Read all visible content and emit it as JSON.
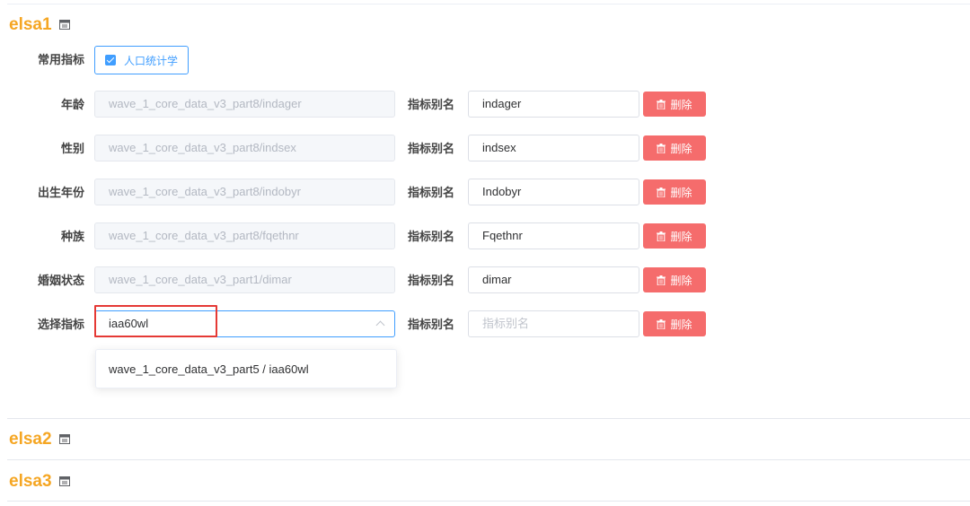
{
  "sections": [
    {
      "title": "elsa1",
      "icon": "calendar-icon"
    },
    {
      "title": "elsa2",
      "icon": "calendar-icon"
    },
    {
      "title": "elsa3",
      "icon": "calendar-icon"
    }
  ],
  "common": {
    "label": "常用指标",
    "checkbox_label": "人口统计学",
    "checked": true
  },
  "alias_label": "指标别名",
  "delete_label": "删除",
  "indicators": [
    {
      "label": "年龄",
      "path": "wave_1_core_data_v3_part8/indager",
      "alias": "indager"
    },
    {
      "label": "性别",
      "path": "wave_1_core_data_v3_part8/indsex",
      "alias": "indsex"
    },
    {
      "label": "出生年份",
      "path": "wave_1_core_data_v3_part8/indobyr",
      "alias": "Indobyr"
    },
    {
      "label": "种族",
      "path": "wave_1_core_data_v3_part8/fqethnr",
      "alias": "Fqethnr"
    },
    {
      "label": "婚姻状态",
      "path": "wave_1_core_data_v3_part1/dimar",
      "alias": "dimar"
    }
  ],
  "select_row": {
    "label": "选择指标",
    "value": "iaa60wl",
    "alias_placeholder": "指标别名"
  },
  "dropdown": {
    "options": [
      "wave_1_core_data_v3_part5 / iaa60wl"
    ]
  },
  "colors": {
    "section_title": "#f5a623",
    "primary": "#409eff",
    "danger": "#f56c6c",
    "highlight": "#e53935"
  }
}
